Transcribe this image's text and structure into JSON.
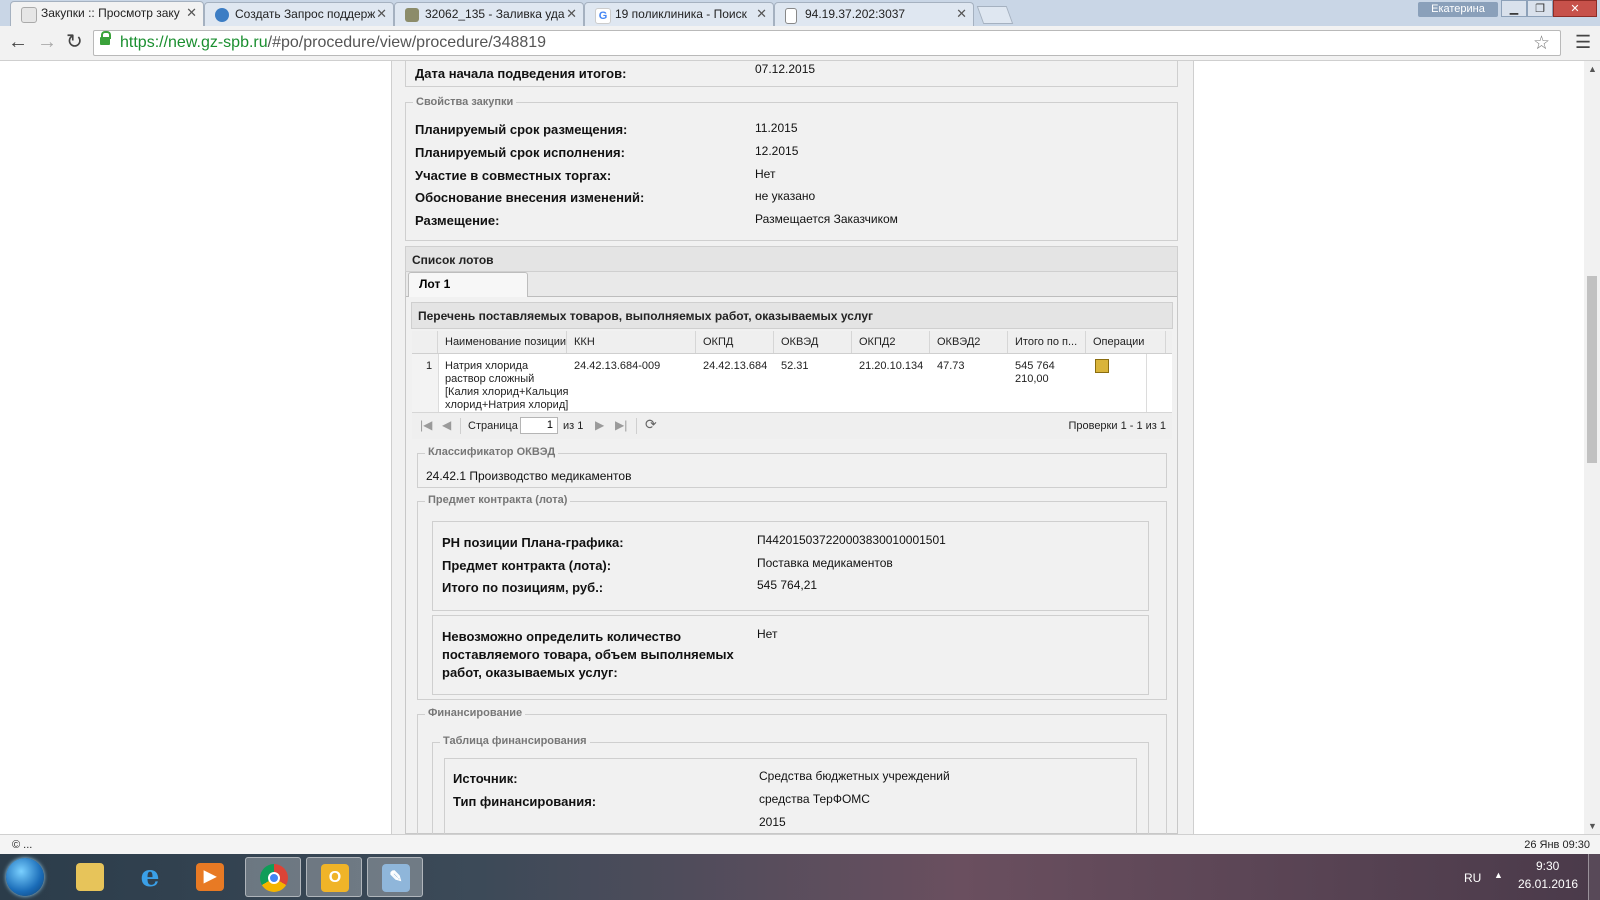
{
  "browser": {
    "tabs": [
      {
        "title": "Закупки :: Просмотр заку",
        "active": true
      },
      {
        "title": "Создать Запрос поддерж",
        "active": false
      },
      {
        "title": "32062_135 - Заливка уда",
        "active": false
      },
      {
        "title": "19 поликлиника - Поиск",
        "active": false
      },
      {
        "title": "94.19.37.202:3037",
        "active": false
      }
    ],
    "user": "Екатерина",
    "url_secure": "https://new.gz-spb.ru",
    "url_rest": "/#po/procedure/view/procedure/348819"
  },
  "top": {
    "summary_date_label": "Дата начала подведения итогов:",
    "summary_date_value": "07.12.2015"
  },
  "properties": {
    "legend": "Свойства закупки",
    "rows": [
      {
        "label": "Планируемый срок размещения:",
        "value": "11.2015"
      },
      {
        "label": "Планируемый срок исполнения:",
        "value": "12.2015"
      },
      {
        "label": "Участие в совместных торгах:",
        "value": "Нет"
      },
      {
        "label": "Обоснование внесения изменений:",
        "value": "не указано"
      },
      {
        "label": "Размещение:",
        "value": "Размещается Заказчиком"
      }
    ]
  },
  "lots": {
    "header": "Список лотов",
    "tab": "Лот 1",
    "items_header": "Перечень поставляемых товаров, выполняемых работ, оказываемых услуг",
    "columns": [
      "Наименование позиции",
      "ККН",
      "ОКПД",
      "ОКВЭД",
      "ОКПД2",
      "ОКВЭД2",
      "Итого по п...",
      "Операции"
    ],
    "rows": [
      {
        "num": "1",
        "name": [
          "Натрия хлорида",
          "раствор сложный",
          "[Калия хлорид+Кальция",
          "хлорид+Натрия хлорид]"
        ],
        "kkn": "24.42.13.684-009",
        "okpd": "24.42.13.684",
        "okved": "52.31",
        "okpd2": "21.20.10.134",
        "okved2": "47.73",
        "total": [
          "545 764",
          "210,00"
        ]
      }
    ],
    "pager": {
      "page_label": "Страница",
      "page_value": "1",
      "of_label": "из 1",
      "summary": "Проверки 1 - 1 из 1"
    }
  },
  "okved": {
    "legend": "Классификатор ОКВЭД",
    "value": "24.42.1 Производство медикаментов"
  },
  "subject": {
    "legend": "Предмет контракта (лота)",
    "rows": [
      {
        "label": "РН позиции Плана-графика:",
        "value": "П442015037220003830010001501"
      },
      {
        "label": "Предмет контракта (лота):",
        "value": "Поставка медикаментов"
      },
      {
        "label": "Итого по позициям, руб.:",
        "value": "545 764,21"
      }
    ],
    "quantity_label": [
      "Невозможно определить количество",
      "поставляемого товара, объем выполняемых",
      "работ, оказываемых услуг:"
    ],
    "quantity_value": "Нет"
  },
  "financing": {
    "legend": "Финансирование",
    "table_legend": "Таблица финансирования",
    "rows": [
      {
        "label": "Источник:",
        "value": "Средства бюджетных учреждений"
      },
      {
        "label": "Тип финансирования:",
        "value": "средства ТерФОМС"
      }
    ],
    "partial_value": "2015"
  },
  "status": {
    "left": "© ...",
    "right": "26 Янв 09:30"
  },
  "taskbar": {
    "lang": "RU",
    "time": "9:30",
    "date": "26.01.2016"
  }
}
